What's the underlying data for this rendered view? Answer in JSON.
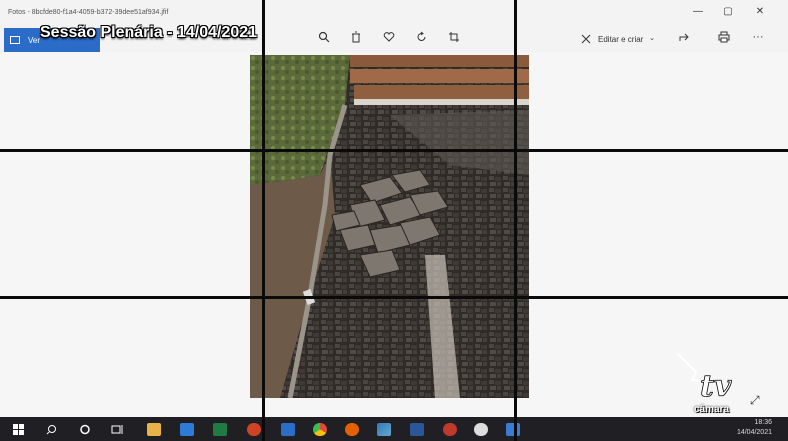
{
  "window": {
    "title": "Fotos - 8bcfde80-f1a4-4059-b372-39dee51af934.jfif",
    "minimize": "—",
    "maximize": "▢",
    "close": "✕"
  },
  "toolbar": {
    "view_all_label": "Ver",
    "edit_create_label": "Editar e criar",
    "icons": [
      "zoom-icon",
      "trash-icon",
      "heart-icon",
      "rotate-icon",
      "crop-icon",
      "share-icon",
      "print-icon",
      "more-icon"
    ]
  },
  "overlay": {
    "session_title": "Sessão Plenária - 14/04/2021"
  },
  "broadcast_logo": {
    "text": "câmara"
  },
  "taskbar": {
    "time": "18:36",
    "date": "14/04/2021",
    "apps": [
      "windows-start",
      "search",
      "cortana",
      "task-view",
      "file-explorer",
      "mail",
      "excel",
      "powerpoint",
      "outlook",
      "chrome",
      "firefox",
      "edge",
      "word-app",
      "app-red",
      "app-white",
      "photos"
    ],
    "colors": {
      "file-explorer": "#e8b24a",
      "mail": "#2d7bd6",
      "excel": "#1f7a43",
      "powerpoint": "#d04423",
      "outlook": "#2a6ec9",
      "chrome": "#dd4b39",
      "firefox": "#e66000",
      "edge": "#3277bc",
      "word-app": "#2b579a",
      "app-red": "#c0392b",
      "app-white": "#dddddd",
      "photos": "#3a7bd5"
    }
  }
}
